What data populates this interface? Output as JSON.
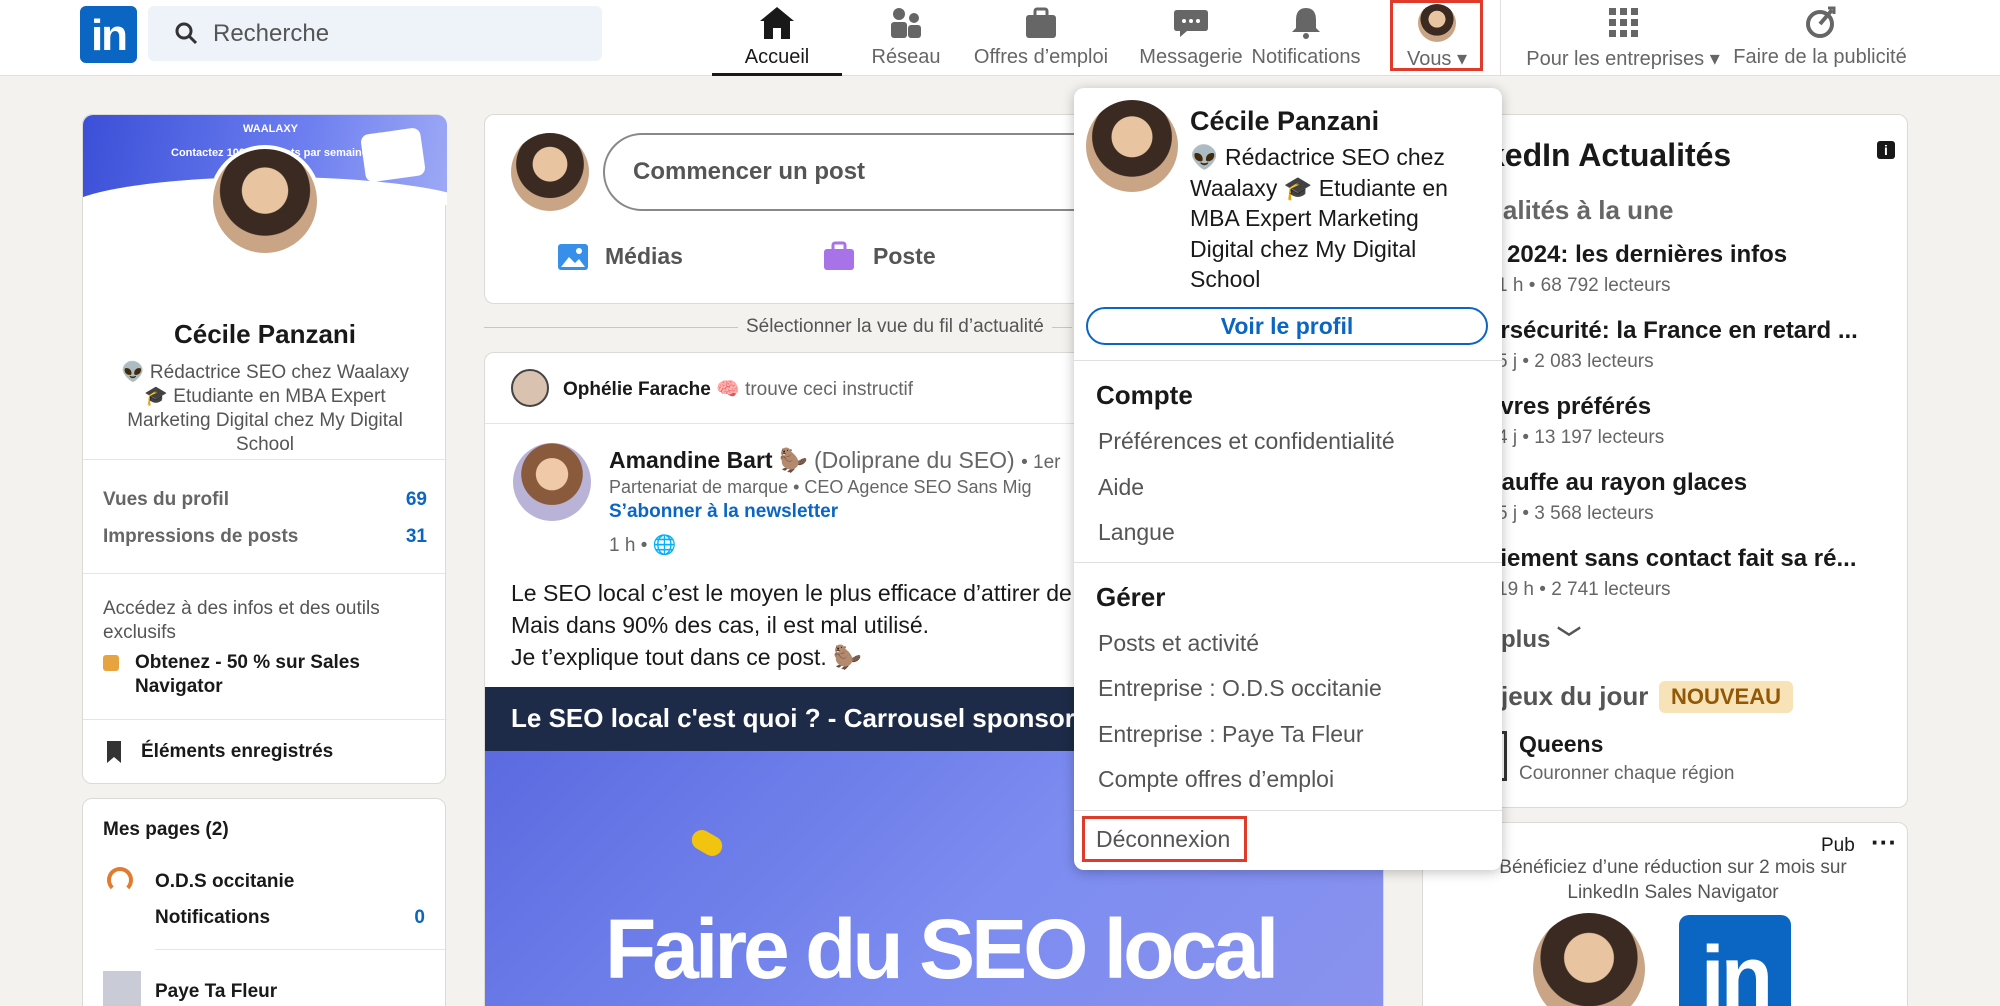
{
  "nav": {
    "search_placeholder": "Recherche",
    "items": [
      {
        "label": "Accueil"
      },
      {
        "label": "Réseau"
      },
      {
        "label": "Offres d’emploi"
      },
      {
        "label": "Messagerie"
      },
      {
        "label": "Notifications"
      },
      {
        "label": "Vous"
      },
      {
        "label": "Pour les entreprises"
      },
      {
        "label": "Faire de la publicité"
      }
    ]
  },
  "profile": {
    "name": "Cécile Panzani",
    "headline": "👽 Rédactrice SEO chez Waalaxy 🎓 Etudiante en MBA Expert Marketing Digital chez My Digital School",
    "cover_text": "Contactez 100 prospects par semaine.",
    "cover_brand": "WAALAXY",
    "stats": [
      {
        "label": "Vues du profil",
        "value": "69"
      },
      {
        "label": "Impressions de posts",
        "value": "31"
      }
    ],
    "premium_text": "Accédez à des infos et des outils exclusifs",
    "premium_offer": "Obtenez - 50 % sur Sales Navigator",
    "saved": "Éléments enregistrés"
  },
  "pages": {
    "title": "Mes pages (2)",
    "items": [
      {
        "name": "O.D.S occitanie",
        "sub": "Notifications",
        "count": "0"
      },
      {
        "name": "Paye Ta Fleur"
      }
    ]
  },
  "composer": {
    "placeholder": "Commencer un post",
    "media": "Médias",
    "job": "Poste"
  },
  "feed_sort": "Sélectionner la vue du fil d’actualité",
  "post": {
    "reactor": "Ophélie Farache",
    "reaction": "trouve ceci instructif",
    "author": "Amandine Bart",
    "author_suffix": "(Doliprane du SEO)",
    "degree": "• 1er",
    "subtitle": "Partenariat de marque • CEO Agence SEO Sans Mig",
    "newsletter": "S’abonner à la newsletter",
    "time": "1 h •",
    "lines": [
      "Le SEO local c’est le moyen le plus efficace d’attirer de",
      "Mais dans 90% des cas, il est mal utilisé.",
      "Je t’explique tout dans ce post. 🦫"
    ],
    "banner": "Le SEO local c'est quoi ? - Carrousel sponsoris",
    "image_text": "Faire du SEO local"
  },
  "dropdown": {
    "name": "Cécile Panzani",
    "headline": "👽 Rédactrice SEO chez Waalaxy 🎓 Etudiante en MBA Expert Marketing Digital chez My Digital School",
    "view_profile": "Voir le profil",
    "account_title": "Compte",
    "account_links": [
      "Préférences et confidentialité",
      "Aide",
      "Langue"
    ],
    "manage_title": "Gérer",
    "manage_links": [
      "Posts et activité",
      "Entreprise : O.D.S occitanie",
      "Entreprise : Paye Ta Fleur",
      "Compte offres d’emploi"
    ],
    "logout": "Déconnexion"
  },
  "news": {
    "title": "kedIn Actualités",
    "subtitle": "ualités à la une",
    "items": [
      {
        "headline": "s 2024: les dernières infos",
        "meta": "1 h • 68 792 lecteurs"
      },
      {
        "headline": "ersécurité: la France en retard ...",
        "meta": "5 j • 2 083 lecteurs"
      },
      {
        "headline": "livres préférés",
        "meta": "4 j • 13 197 lecteurs"
      },
      {
        "headline": "hauffe au rayon glaces",
        "meta": "5 j • 3 568 lecteurs"
      },
      {
        "headline": "aiement sans contact fait sa ré...",
        "meta": "19 h • 2 741 lecteurs"
      }
    ],
    "more": "plus",
    "games_title": "jeux du jour",
    "games_badge": "NOUVEAU",
    "game_name": "Queens",
    "game_desc": "Couronner chaque région"
  },
  "ad": {
    "label": "Pub",
    "text": "Bénéficiez d’une réduction sur 2 mois sur LinkedIn Sales Navigator"
  },
  "colors": {
    "brand": "#0a66c2",
    "highlight": "#e03a2b",
    "badge": "#f8e2b8"
  }
}
